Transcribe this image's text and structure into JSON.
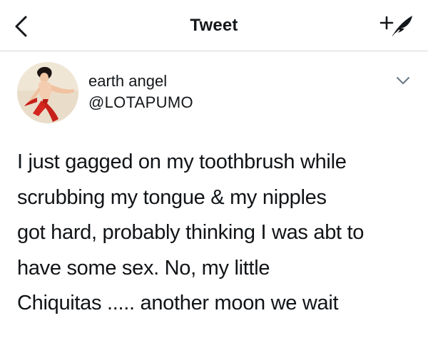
{
  "nav": {
    "back_icon": "chevron-left-icon",
    "title": "Tweet",
    "compose_icon": "plus-feather-icon"
  },
  "author": {
    "name": "earth angel",
    "handle": "@LOTAPUMO",
    "avatar_icon": "avatar-image",
    "menu_icon": "chevron-down-icon"
  },
  "tweet": {
    "lines": [
      "I just gagged on my toothbrush while",
      "scrubbing my tongue & my nipples",
      "got hard, probably thinking I was abt to",
      "have some sex. No, my little",
      "Chiquitas ..... another moon we wait"
    ]
  },
  "colors": {
    "text": "#14171a",
    "divider": "#d6d9dc",
    "background": "#ffffff"
  }
}
